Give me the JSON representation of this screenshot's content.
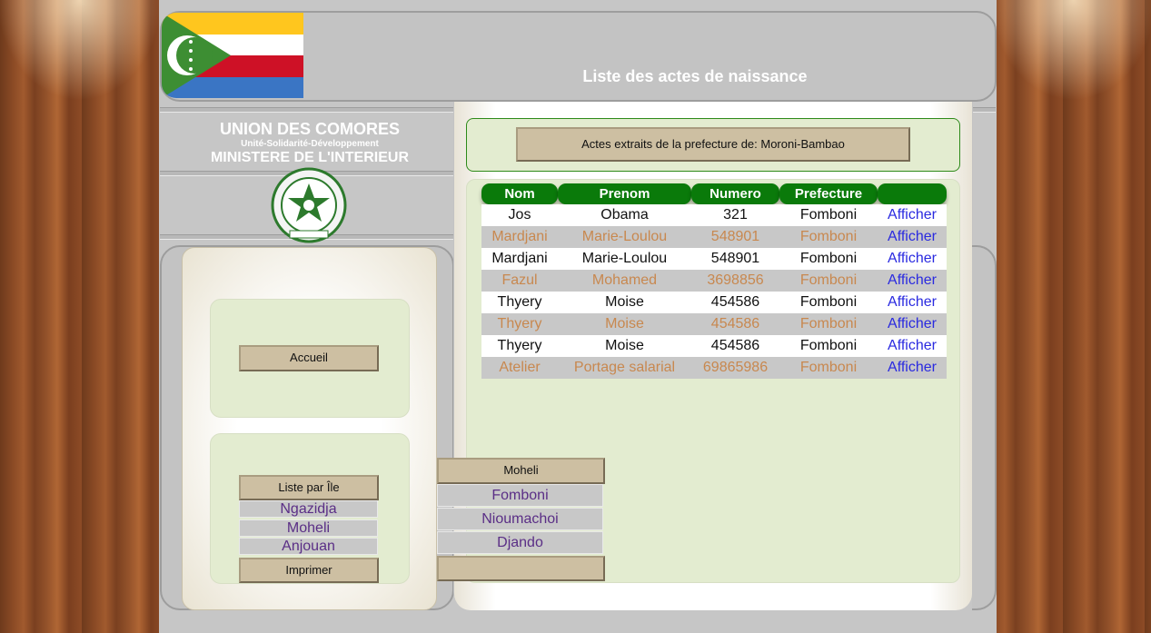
{
  "header": {
    "title": "Liste des actes de naissance"
  },
  "organization": {
    "name": "UNION DES COMORES",
    "motto": "Unité-Solidarité-Développement",
    "ministry": "MINISTERE DE L'INTERIEUR"
  },
  "subtitle": "Actes extraits de la prefecture de: Moroni-Bambao",
  "table": {
    "headers": [
      "Nom",
      "Prenom",
      "Numero",
      "Prefecture",
      ""
    ],
    "rows": [
      {
        "nom": "Jos",
        "prenom": "Obama",
        "numero": "321",
        "prefecture": "Fomboni",
        "action": "Afficher"
      },
      {
        "nom": "Mardjani",
        "prenom": "Marie-Loulou",
        "numero": "548901",
        "prefecture": "Fomboni",
        "action": "Afficher"
      },
      {
        "nom": "Mardjani",
        "prenom": "Marie-Loulou",
        "numero": "548901",
        "prefecture": "Fomboni",
        "action": "Afficher"
      },
      {
        "nom": "Fazul",
        "prenom": "Mohamed",
        "numero": "3698856",
        "prefecture": "Fomboni",
        "action": "Afficher"
      },
      {
        "nom": "Thyery",
        "prenom": "Moise",
        "numero": "454586",
        "prefecture": "Fomboni",
        "action": "Afficher"
      },
      {
        "nom": "Thyery",
        "prenom": "Moise",
        "numero": "454586",
        "prefecture": "Fomboni",
        "action": "Afficher"
      },
      {
        "nom": "Thyery",
        "prenom": "Moise",
        "numero": "454586",
        "prefecture": "Fomboni",
        "action": "Afficher"
      },
      {
        "nom": "Atelier",
        "prenom": "Portage salarial",
        "numero": "69865986",
        "prefecture": "Fomboni",
        "action": "Afficher"
      }
    ]
  },
  "menu": {
    "home": "Accueil",
    "list_by_island": "Liste par Île",
    "islands": [
      "Ngazidja",
      "Moheli",
      "Anjouan"
    ],
    "print": "Imprimer"
  },
  "submenu": {
    "island": "Moheli",
    "prefectures": [
      "Fomboni",
      "Nioumachoi",
      "Djando"
    ],
    "empty": ""
  },
  "colors": {
    "header_green": "#0a7a0a",
    "panel_green": "#e3ecd0",
    "button_tan": "#cdbfa2",
    "link_purple": "#5a2e86",
    "link_blue": "#2a2ae0",
    "alt_row_text": "#c8884f"
  },
  "icons": {
    "flag": "comoros-flag-icon",
    "seal": "ministry-seal-icon"
  }
}
